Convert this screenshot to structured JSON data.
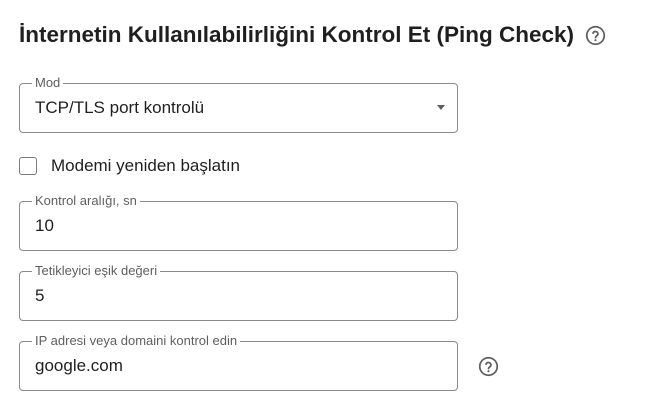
{
  "page": {
    "title": "İnternetin Kullanılabilirliğini Kontrol Et (Ping Check)",
    "title_help_icon": "question-circle-icon"
  },
  "fields": {
    "mode": {
      "label": "Mod",
      "value": "TCP/TLS port kontrolü"
    },
    "restart_modem": {
      "label": "Modemi yeniden başlatın",
      "checked": false
    },
    "interval": {
      "label": "Kontrol aralığı, sn",
      "value": "10"
    },
    "threshold": {
      "label": "Tetikleyici eşik değeri",
      "value": "5"
    },
    "target": {
      "label": "IP adresi veya domaini kontrol edin",
      "value": "google.com",
      "help_icon": "question-circle-icon"
    }
  },
  "colors": {
    "text": "#1f1f1f",
    "label": "#5f5f5f",
    "border": "#8a8a8a",
    "icon": "#5f5f5f"
  }
}
